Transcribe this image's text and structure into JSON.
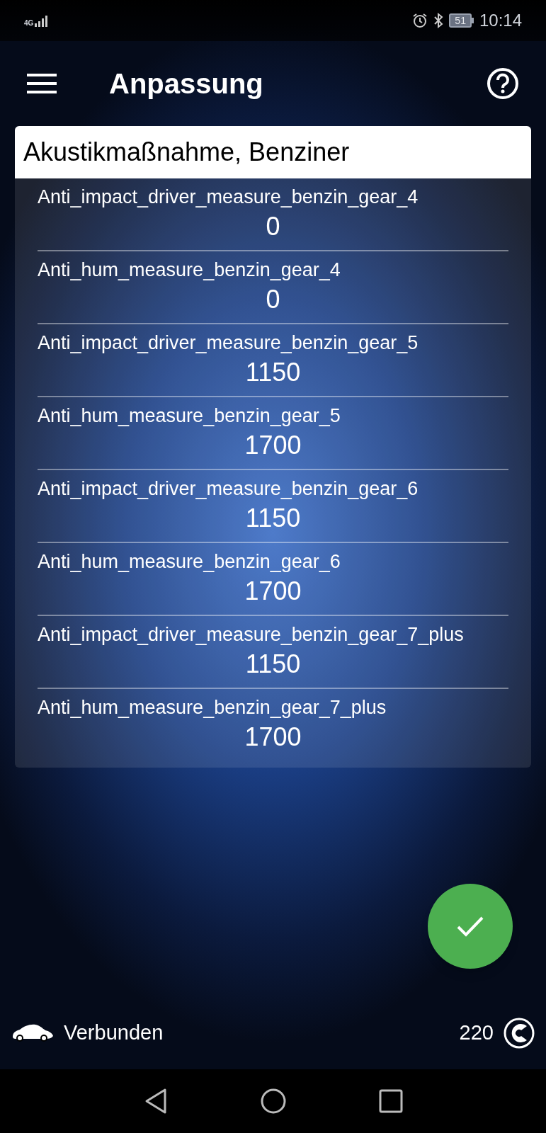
{
  "status_bar": {
    "network": "4G",
    "battery": "51",
    "time": "10:14"
  },
  "app_bar": {
    "title": "Anpassung"
  },
  "card": {
    "title": "Akustikmaßnahme, Benziner",
    "rows": [
      {
        "label": "Anti_impact_driver_measure_benzin_gear_4",
        "value": "0"
      },
      {
        "label": "Anti_hum_measure_benzin_gear_4",
        "value": "0"
      },
      {
        "label": "Anti_impact_driver_measure_benzin_gear_5",
        "value": "1150"
      },
      {
        "label": "Anti_hum_measure_benzin_gear_5",
        "value": "1700"
      },
      {
        "label": "Anti_impact_driver_measure_benzin_gear_6",
        "value": "1150"
      },
      {
        "label": "Anti_hum_measure_benzin_gear_6",
        "value": "1700"
      },
      {
        "label": "Anti_impact_driver_measure_benzin_gear_7_plus",
        "value": "1150"
      },
      {
        "label": "Anti_hum_measure_benzin_gear_7_plus",
        "value": "1700"
      }
    ]
  },
  "footer": {
    "connection": "Verbunden",
    "count": "220"
  }
}
